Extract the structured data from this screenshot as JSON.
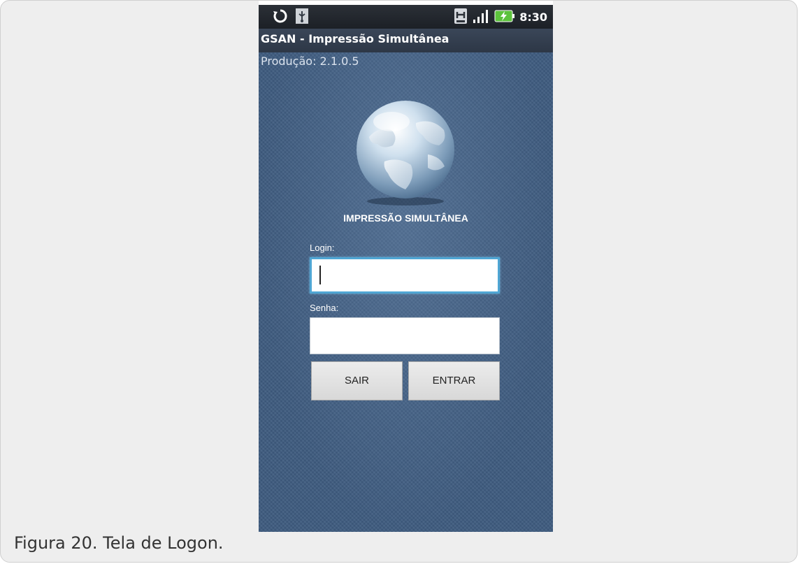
{
  "status_bar": {
    "left_icons": [
      "sync-icon",
      "usb-icon"
    ],
    "right_icons": [
      "notification-icon",
      "signal-icon",
      "battery-charging-icon"
    ],
    "time": "8:30"
  },
  "app": {
    "title": "GSAN - Impressão Simultânea",
    "version": "Produção: 2.1.0.5",
    "brand_label": "IMPRESSÃO SIMULTÂNEA",
    "logo_icon": "globe-icon"
  },
  "form": {
    "login_label": "Login:",
    "login_value": "",
    "senha_label": "Senha:",
    "senha_value": "",
    "sair_label": "SAIR",
    "entrar_label": "ENTRAR"
  },
  "caption": "Figura 20. Tela de Logon.",
  "colors": {
    "page_background": "#eeeeee",
    "screen_background": "#3e5b7f",
    "focus_border": "#4fa6d4"
  }
}
